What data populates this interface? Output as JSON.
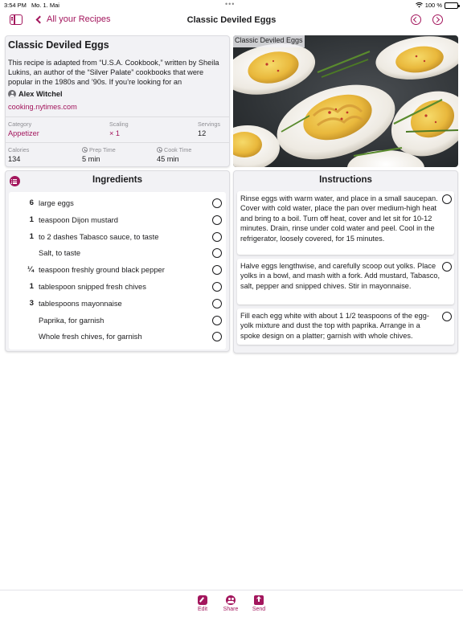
{
  "status_bar": {
    "time": "3:54 PM",
    "date": "Mo. 1. Mai",
    "battery": "100 %"
  },
  "nav": {
    "back_label": "All your Recipes",
    "title": "Classic Deviled Eggs",
    "icons": [
      "sidebar-icon",
      "chevron-left-icon",
      "undo-icon",
      "redo-icon"
    ]
  },
  "recipe": {
    "title": "Classic Deviled Eggs",
    "description": "This recipe is adapted from “U.S.A. Cookbook,” written by Sheila Lukins, an author of the “Silver Palate” cookbooks that were popular in the 1980s and ’90s. If you’re looking for an",
    "author": "Alex Witchel",
    "source": "cooking.nytimes.com",
    "category": {
      "label": "Category",
      "value": "Appetizer"
    },
    "scaling": {
      "label": "Scaling",
      "value": "× 1"
    },
    "servings": {
      "label": "Servings",
      "value": "12"
    },
    "calories": {
      "label": "Calories",
      "value": "134"
    },
    "prep_time": {
      "label": "Prep Time",
      "value": "5 min"
    },
    "cook_time": {
      "label": "Cook Time",
      "value": "45 min"
    }
  },
  "photo": {
    "caption": "Classic Deviled Eggs"
  },
  "ingredients": {
    "title": "Ingredients",
    "items": [
      {
        "qty": "6",
        "text": "large eggs"
      },
      {
        "qty": "1",
        "text": "teaspoon Dijon mustard"
      },
      {
        "qty": "1",
        "text": "to 2 dashes Tabasco sauce, to taste"
      },
      {
        "qty": "",
        "text": "Salt, to taste"
      },
      {
        "qty": "¼",
        "text": "teaspoon freshly ground black pepper"
      },
      {
        "qty": "1",
        "text": "tablespoon snipped fresh chives"
      },
      {
        "qty": "3",
        "text": "tablespoons mayonnaise"
      },
      {
        "qty": "",
        "text": "Paprika, for garnish"
      },
      {
        "qty": "",
        "text": "Whole fresh chives, for garnish"
      }
    ]
  },
  "instructions": {
    "title": "Instructions",
    "steps": [
      "Rinse eggs with warm water, and place in a small saucepan. Cover with cold water, place the pan over medium-high heat and bring to a boil. Turn off heat, cover and let sit for 10-12 minutes. Drain, rinse under cold water and peel. Cool in the refrigerator, loosely covered, for 15 minutes.",
      "Halve eggs lengthwise, and carefully scoop out yolks. Place yolks in a bowl, and mash with a fork. Add mustard, Tabasco, salt, pepper and snipped chives. Stir in mayonnaise.",
      "Fill each egg white with about 1 1/2 teaspoons of the egg-yolk mixture and dust the top with paprika. Arrange in a spoke design on a platter; garnish with whole chives."
    ]
  },
  "toolbar": {
    "edit_label": "Edit",
    "share_label": "Share",
    "send_label": "Send"
  },
  "colors": {
    "accent": "#a3165d",
    "card_bg": "#f2f2f5",
    "background": "#ffffff"
  }
}
